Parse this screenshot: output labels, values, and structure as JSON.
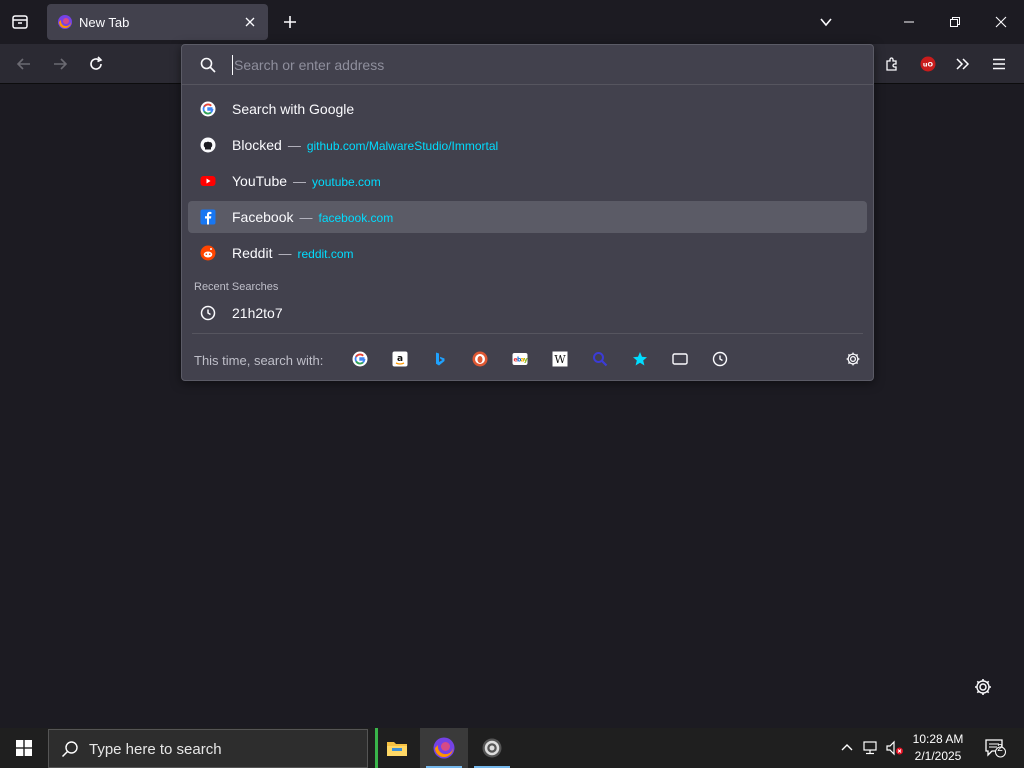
{
  "tab": {
    "title": "New Tab"
  },
  "urlbar": {
    "placeholder": "Search or enter address"
  },
  "suggestions": [
    {
      "label": "Search with Google",
      "sep": "",
      "url": ""
    },
    {
      "label": "Blocked",
      "sep": "—",
      "url": "github.com/MalwareStudio/Immortal"
    },
    {
      "label": "YouTube",
      "sep": "—",
      "url": "youtube.com"
    },
    {
      "label": "Facebook",
      "sep": "—",
      "url": "facebook.com"
    },
    {
      "label": "Reddit",
      "sep": "—",
      "url": "reddit.com"
    }
  ],
  "recent": {
    "label": "Recent Searches",
    "items": [
      {
        "label": "21h2to7"
      }
    ]
  },
  "oneoff": {
    "label": "This time, search with:",
    "engines": [
      "google",
      "amazon",
      "bing",
      "duckduckgo",
      "ebay",
      "wikipedia",
      "search-engine",
      "bookmarks",
      "tabs",
      "history"
    ]
  },
  "taskbar": {
    "search_placeholder": "Type here to search",
    "time": "10:28 AM",
    "date": "2/1/2025",
    "notification_count": "2"
  },
  "colors": {
    "accent_url": "#00ddff",
    "panel_bg": "#42414d",
    "selected_row": "#5b5b66",
    "toolbar_bg": "#2b2a33",
    "content_bg": "#1c1b22"
  }
}
